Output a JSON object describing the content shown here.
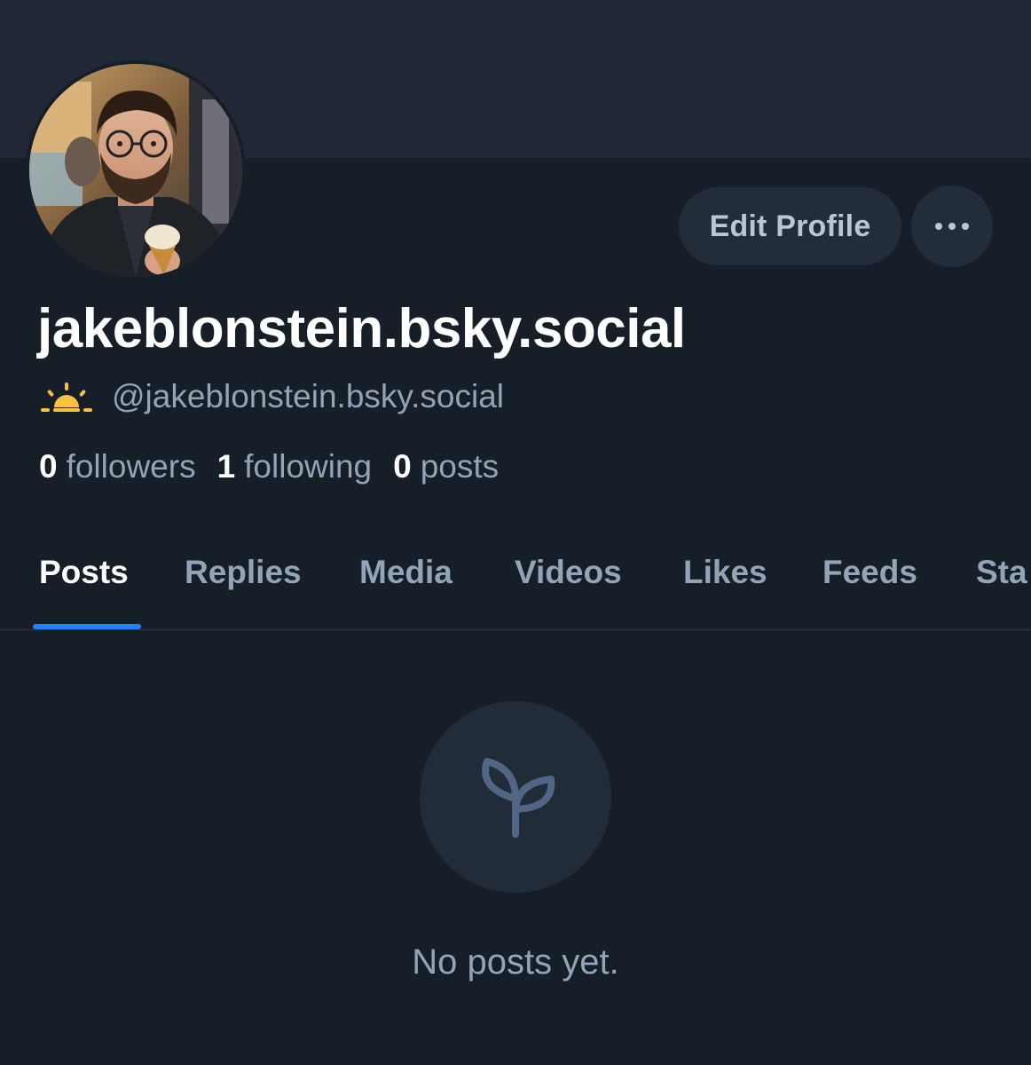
{
  "profile": {
    "display_name": "jakeblonstein.bsky.social",
    "handle": "@jakeblonstein.bsky.social",
    "handle_icon": "sunrise-icon",
    "avatar_icon": "avatar-photo"
  },
  "actions": {
    "edit_profile_label": "Edit Profile",
    "more_icon": "ellipsis-icon"
  },
  "stats": {
    "followers_count": "0",
    "followers_label": "followers",
    "following_count": "1",
    "following_label": "following",
    "posts_count": "0",
    "posts_label": "posts"
  },
  "tabs": [
    {
      "label": "Posts",
      "active": true
    },
    {
      "label": "Replies",
      "active": false
    },
    {
      "label": "Media",
      "active": false
    },
    {
      "label": "Videos",
      "active": false
    },
    {
      "label": "Likes",
      "active": false
    },
    {
      "label": "Feeds",
      "active": false
    },
    {
      "label": "Sta",
      "active": false
    }
  ],
  "empty_state": {
    "icon": "seedling-icon",
    "message": "No posts yet."
  },
  "colors": {
    "background": "#161e27",
    "banner": "#202836",
    "accent": "#1d83ff",
    "muted_text": "#93a3b8",
    "sun": "#f5c242"
  }
}
